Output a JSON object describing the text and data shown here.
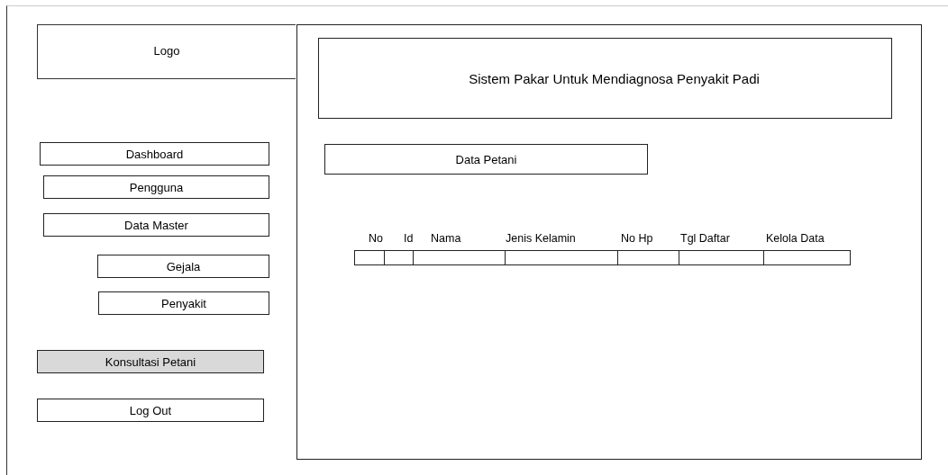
{
  "logo": "Logo",
  "sidebar": {
    "items": [
      {
        "label": "Dashboard",
        "kind": "menu",
        "selected": false
      },
      {
        "label": "Pengguna",
        "kind": "menu",
        "selected": false
      },
      {
        "label": "Data Master",
        "kind": "menu",
        "selected": false
      },
      {
        "label": "Gejala",
        "kind": "submenu",
        "selected": false
      },
      {
        "label": "Penyakit",
        "kind": "submenu",
        "selected": false
      },
      {
        "label": "Konsultasi Petani",
        "kind": "menu",
        "selected": true
      },
      {
        "label": "Log Out",
        "kind": "menu",
        "selected": false
      }
    ]
  },
  "header": {
    "title": "Sistem Pakar Untuk Mendiagnosa Penyakit Padi"
  },
  "section": {
    "title": "Data Petani"
  },
  "table": {
    "columns": [
      "No",
      "Id",
      "Nama",
      "Jenis Kelamin",
      "No Hp",
      "Tgl Daftar",
      "Kelola Data"
    ]
  }
}
